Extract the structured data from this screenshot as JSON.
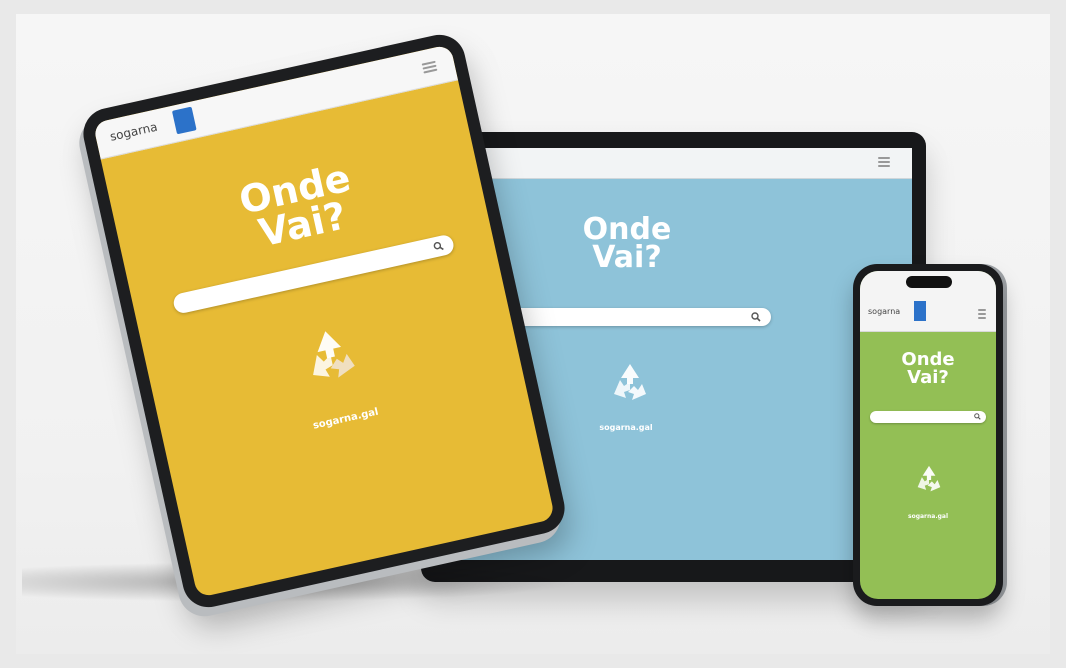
{
  "scene": {
    "background": "#f3f3f3"
  },
  "laptop": {
    "screen_color": "#8ec3d9",
    "title_line1": "Onde",
    "title_line2": "Vai?",
    "search_placeholder": "",
    "url_text": "sogarna.gal",
    "icons": [
      "menu-icon",
      "search-icon",
      "recycle-icon"
    ]
  },
  "tablet": {
    "screen_color": "#e7bb35",
    "brand": "sogarna",
    "title_line1": "Onde",
    "title_line2": "Vai?",
    "search_placeholder": "",
    "url_text": "sogarna.gal",
    "icons": [
      "menu-icon",
      "search-icon",
      "recycle-icon"
    ]
  },
  "phone": {
    "screen_color": "#93bf55",
    "brand": "sogarna",
    "title_line1": "Onde",
    "title_line2": "Vai?",
    "search_placeholder": "",
    "url_text": "sogarna.gal",
    "icons": [
      "menu-icon",
      "search-icon",
      "recycle-icon"
    ]
  }
}
